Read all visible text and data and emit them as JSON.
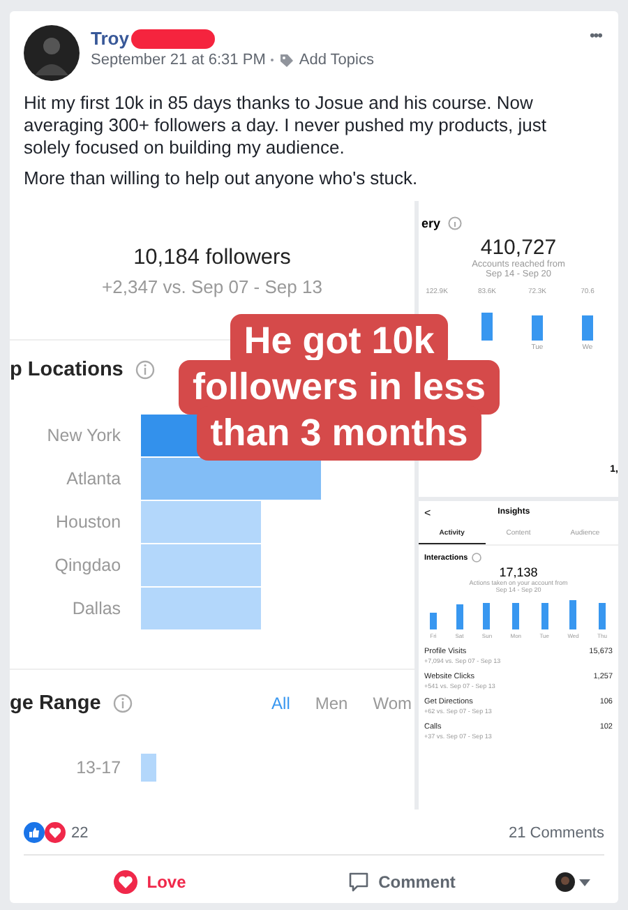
{
  "post": {
    "author": "Troy",
    "redacted": true,
    "date": "September 21 at 6:31 PM",
    "topics_link": "Add Topics",
    "more": "•••",
    "paragraphs": [
      "Hit my first 10k in 85 days thanks to Josue and his course. Now averaging 300+ followers a day. I never pushed my products, just solely focused on building my audience.",
      "More than willing to help out anyone who's stuck."
    ]
  },
  "followers_panel": {
    "count": "10,184 followers",
    "change": "+2,347 vs. Sep 07 - Sep 13",
    "locations_title": "p Locations",
    "locations": [
      {
        "label": "New York",
        "color": "#3391ec"
      },
      {
        "label": "Atlanta",
        "color": "#82bdf6"
      },
      {
        "label": "Houston",
        "color": "#b3d7fb"
      },
      {
        "label": "Qingdao",
        "color": "#b3d7fb"
      },
      {
        "label": "Dallas",
        "color": "#b3d7fb"
      }
    ],
    "age_title": "ge Range",
    "age_tabs": [
      {
        "label": "All",
        "selected": true
      },
      {
        "label": "Men",
        "selected": false
      },
      {
        "label": "Wom",
        "selected": false
      }
    ],
    "ages": [
      {
        "label": "13-17"
      }
    ]
  },
  "reach_panel": {
    "title": "ery",
    "total": "410,727",
    "caption": "Accounts reached from",
    "range": "Sep 14 - Sep 20",
    "bars": [
      {
        "value": "122.9K",
        "hidden": true
      },
      {
        "value": "83.6K",
        "hidden": false
      },
      {
        "value": "72.3K",
        "hidden": false,
        "day": "Tue"
      },
      {
        "value": "70.6",
        "hidden": false,
        "day": "We"
      }
    ],
    "cut_value": "1,"
  },
  "insights_panel": {
    "back": "<",
    "title": "Insights",
    "tabs": [
      {
        "label": "Activity",
        "selected": true
      },
      {
        "label": "Content",
        "selected": false
      },
      {
        "label": "Audience",
        "selected": false
      }
    ],
    "section": "Interactions",
    "total": "17,138",
    "caption": "Actions taken on your account from",
    "range": "Sep 14 - Sep 20",
    "bars": [
      {
        "day": "Fri"
      },
      {
        "day": "Sat"
      },
      {
        "day": "Sun"
      },
      {
        "day": "Mon"
      },
      {
        "day": "Tue"
      },
      {
        "day": "Wed"
      },
      {
        "day": "Thu"
      }
    ],
    "rows": [
      {
        "label": "Profile Visits",
        "change": "+7,094 vs. Sep 07 - Sep 13",
        "value": "15,673"
      },
      {
        "label": "Website Clicks",
        "change": "+541 vs. Sep 07 - Sep 13",
        "value": "1,257"
      },
      {
        "label": "Get Directions",
        "change": "+62 vs. Sep 07 - Sep 13",
        "value": "106"
      },
      {
        "label": "Calls",
        "change": "+37 vs. Sep 07 - Sep 13",
        "value": "102"
      }
    ]
  },
  "caption": [
    "He got 10k",
    "followers in less",
    "than 3 months"
  ],
  "reactions": {
    "count": "22",
    "comments": "21 Comments"
  },
  "actions": [
    {
      "kind": "love",
      "label": "Love",
      "selected": true
    },
    {
      "kind": "comment",
      "label": "Comment",
      "selected": false
    }
  ]
}
